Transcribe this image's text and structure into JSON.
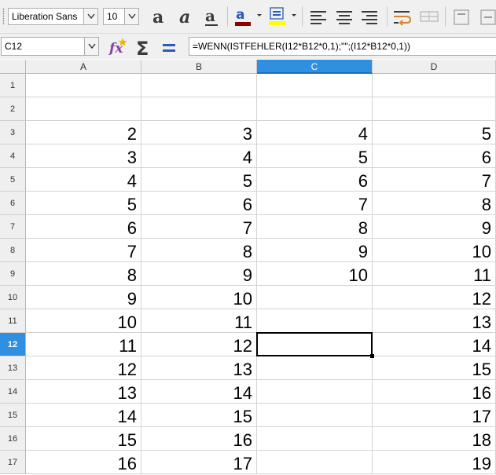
{
  "toolbar": {
    "font_name": "Liberation Sans",
    "font_size": "10",
    "buttons": [
      "bold-icon",
      "italic-icon",
      "underline-icon",
      "font-color-icon",
      "highlight-icon",
      "align-left-icon",
      "align-center-icon",
      "align-right-icon",
      "wrap-text-icon",
      "merge-cells-icon",
      "align-top-icon"
    ],
    "font_color": "#8b0000",
    "highlight_color": "#ffff00"
  },
  "formula_bar": {
    "cell_reference": "C12",
    "formula": "=WENN(ISTFEHLER(I12*B12*0,1);\"\";(I12*B12*0,1))"
  },
  "sheet": {
    "columns": [
      "A",
      "B",
      "C",
      "D"
    ],
    "selected_column": "C",
    "selected_row": "12",
    "rows": [
      {
        "n": "1",
        "cells": [
          "",
          "",
          "",
          ""
        ]
      },
      {
        "n": "2",
        "cells": [
          "",
          "",
          "",
          ""
        ]
      },
      {
        "n": "3",
        "cells": [
          "2",
          "3",
          "4",
          "5"
        ]
      },
      {
        "n": "4",
        "cells": [
          "3",
          "4",
          "5",
          "6"
        ]
      },
      {
        "n": "5",
        "cells": [
          "4",
          "5",
          "6",
          "7"
        ]
      },
      {
        "n": "6",
        "cells": [
          "5",
          "6",
          "7",
          "8"
        ]
      },
      {
        "n": "7",
        "cells": [
          "6",
          "7",
          "8",
          "9"
        ]
      },
      {
        "n": "8",
        "cells": [
          "7",
          "8",
          "9",
          "10"
        ]
      },
      {
        "n": "9",
        "cells": [
          "8",
          "9",
          "10",
          "11"
        ]
      },
      {
        "n": "10",
        "cells": [
          "9",
          "10",
          "",
          "12"
        ]
      },
      {
        "n": "11",
        "cells": [
          "10",
          "11",
          "",
          "13"
        ]
      },
      {
        "n": "12",
        "cells": [
          "11",
          "12",
          "",
          "14"
        ]
      },
      {
        "n": "13",
        "cells": [
          "12",
          "13",
          "",
          "15"
        ]
      },
      {
        "n": "14",
        "cells": [
          "13",
          "14",
          "",
          "16"
        ]
      },
      {
        "n": "15",
        "cells": [
          "14",
          "15",
          "",
          "17"
        ]
      },
      {
        "n": "16",
        "cells": [
          "15",
          "16",
          "",
          "18"
        ]
      },
      {
        "n": "17",
        "cells": [
          "16",
          "17",
          "",
          "19"
        ]
      }
    ]
  },
  "colors": {
    "selection_header": "#2f8fe0",
    "header_bg": "#efefef",
    "gridline": "#d4d4d4"
  }
}
